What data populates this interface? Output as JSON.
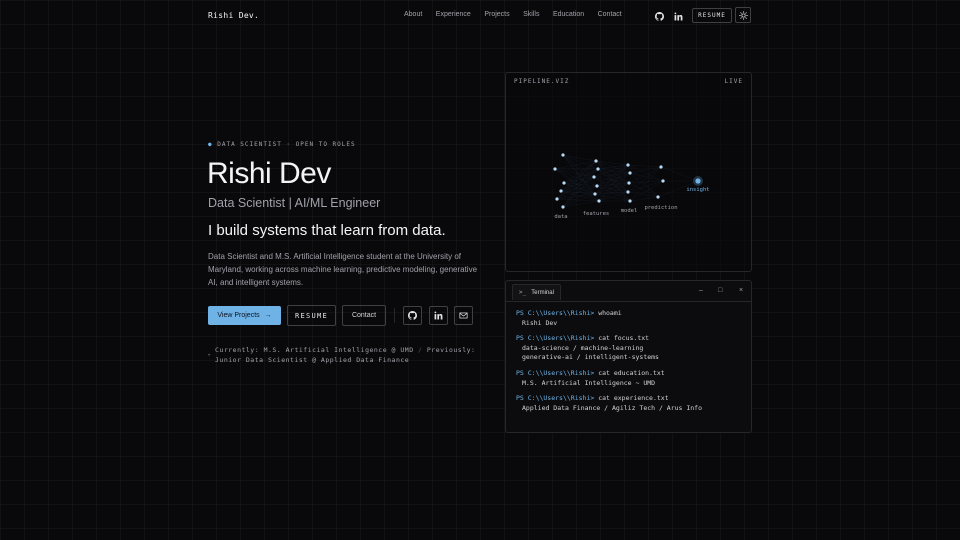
{
  "nav": {
    "logo": "Rishi Dev.",
    "links": [
      "About",
      "Experience",
      "Projects",
      "Skills",
      "Education",
      "Contact"
    ],
    "github_icon": "github-icon",
    "linkedin_icon": "linkedin-icon",
    "resume_label": "RESUME",
    "theme_icon": "sun-icon"
  },
  "hero": {
    "eyebrow": "DATA SCIENTIST · OPEN TO ROLES",
    "name": "Rishi Dev",
    "role": "Data Scientist | AI/ML Engineer",
    "tagline": "I build systems that learn from data.",
    "description": "Data Scientist and M.S. Artificial Intelligence student at the University of Maryland, working across machine learning, predictive modeling, generative AI, and intelligent systems.",
    "primary_button": "View Projects",
    "resume_button": "RESUME",
    "contact_button": "Contact",
    "status_line1_label": "Currently:",
    "status_line1_value": "M.S. Artificial Intelligence @ UMD",
    "status_sep": "/",
    "status_line1_label2": "Previously:",
    "status_line2_value": "Junior Data Scientist @ Applied Data Finance"
  },
  "pipeline": {
    "title": "PIPELINE.VIZ",
    "status": "LIVE",
    "stages": [
      "data",
      "features",
      "model",
      "prediction",
      "insight"
    ],
    "accent": "#6fb3e6"
  },
  "terminal": {
    "tab_label": "Terminal",
    "prompt": "PS C:\\\\Users\\\\Rishi>",
    "blocks": [
      {
        "cmd": "whoami",
        "out": [
          "Rishi Dev"
        ]
      },
      {
        "cmd": "cat focus.txt",
        "out": [
          "data-science / machine-learning",
          "generative-ai / intelligent-systems"
        ]
      },
      {
        "cmd": "cat education.txt",
        "out": [
          "M.S. Artificial Intelligence ~ UMD"
        ]
      },
      {
        "cmd": "cat experience.txt",
        "out": [
          "Applied Data Finance / Agiliz Tech / Arus Info"
        ]
      }
    ]
  }
}
